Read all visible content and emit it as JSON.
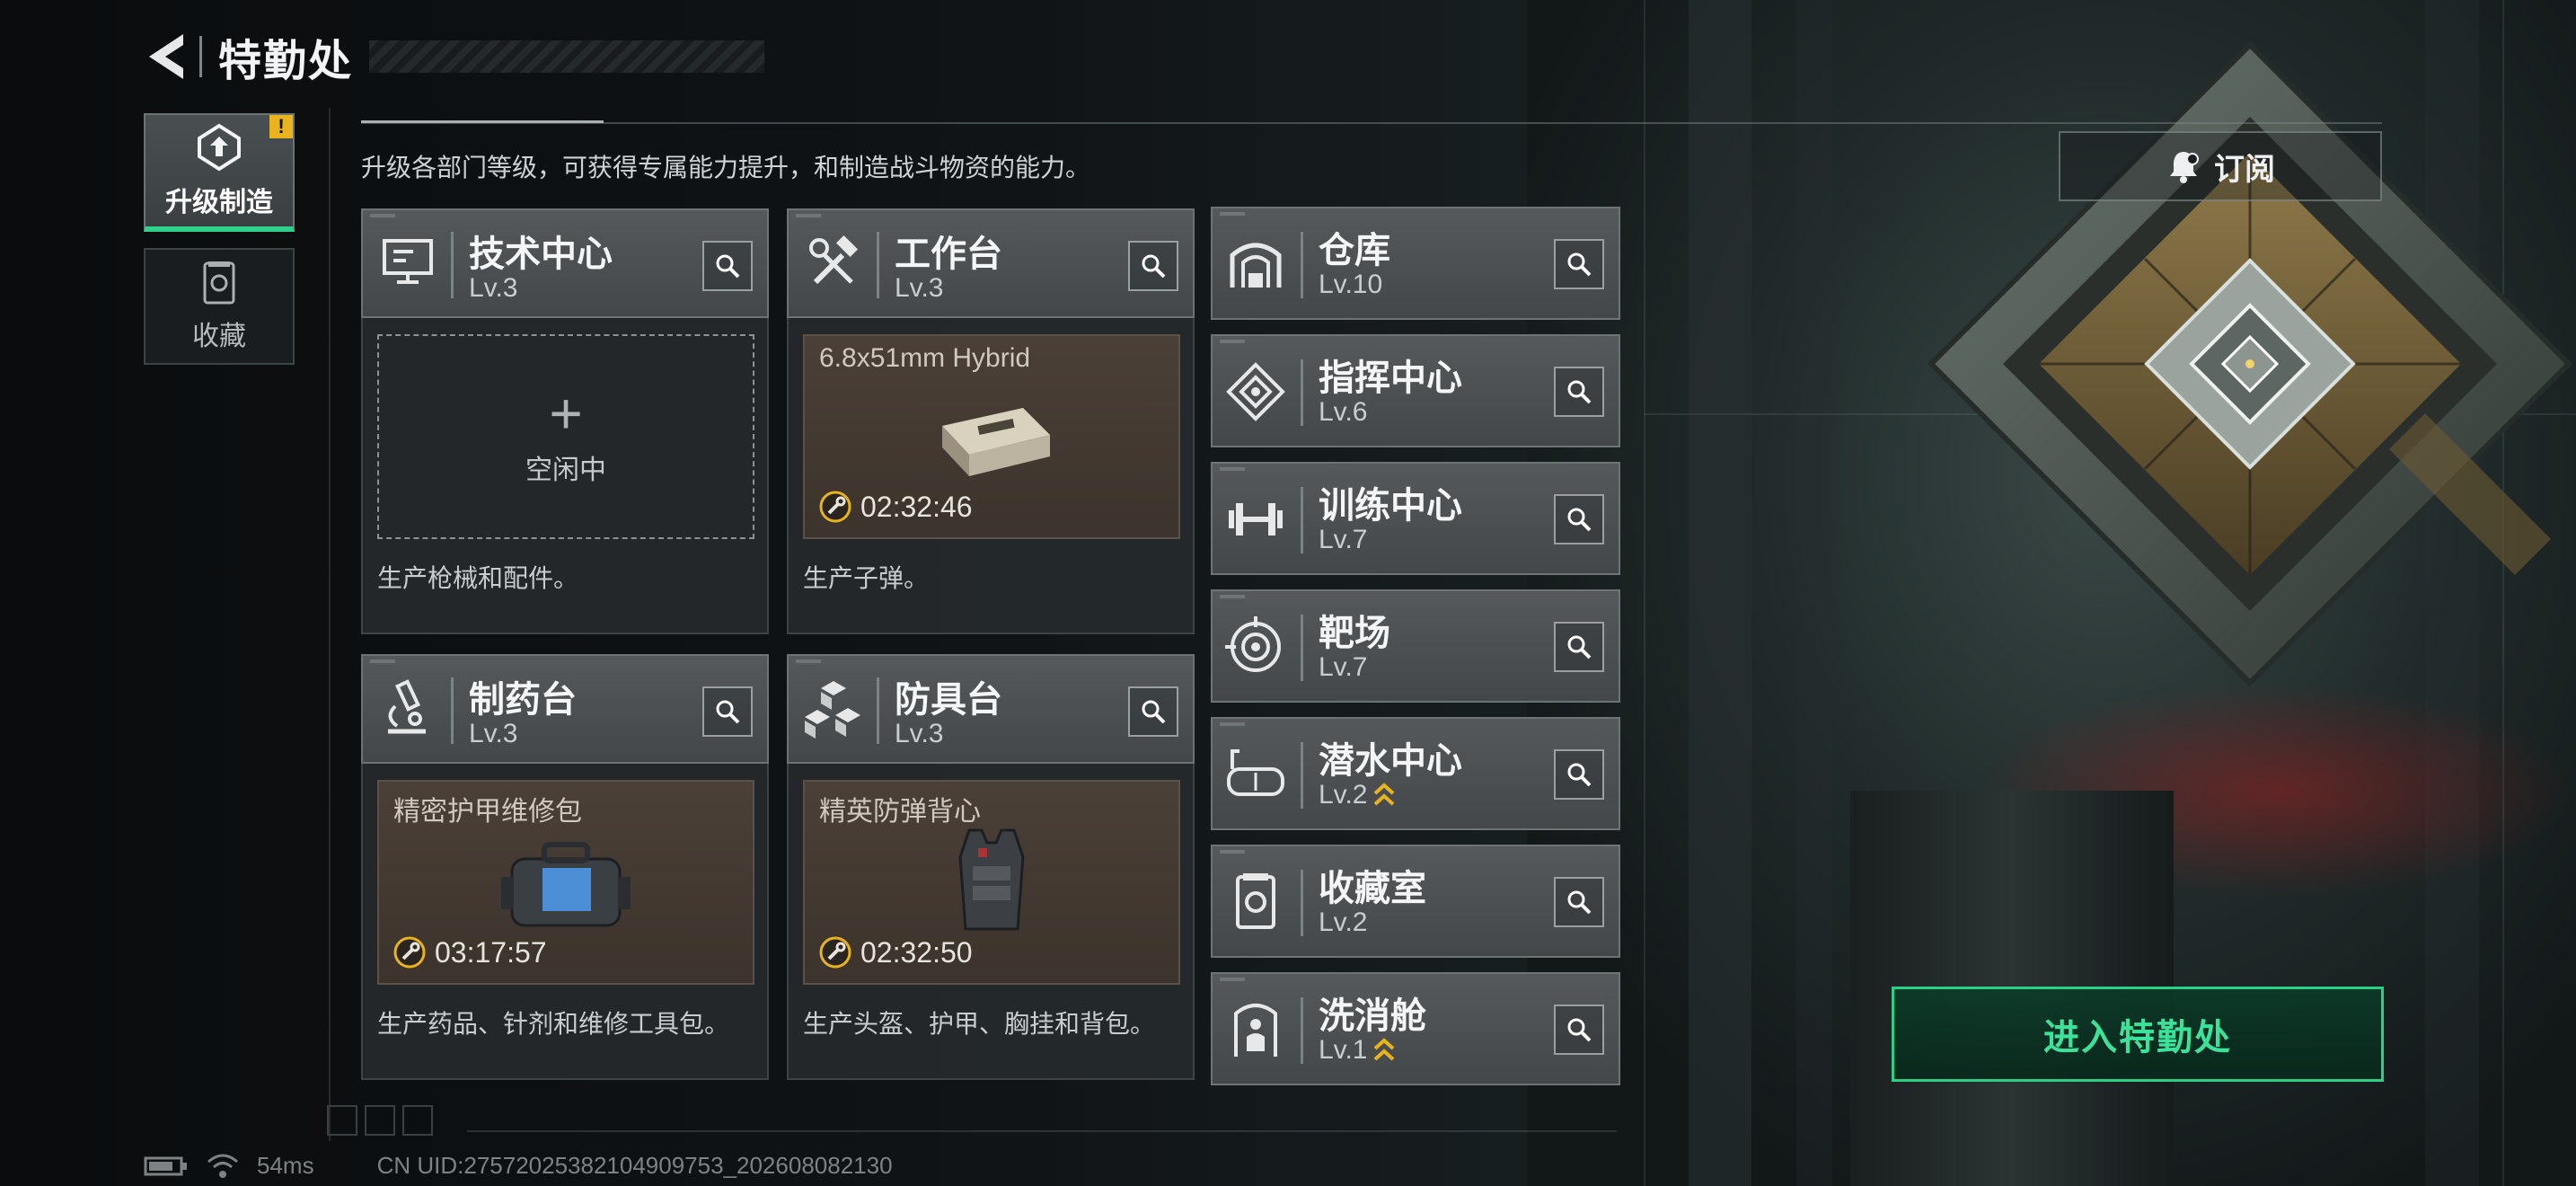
{
  "header": {
    "title": "特勤处"
  },
  "sidebar": {
    "items": [
      {
        "label": "升级制造",
        "active": true,
        "badge": "!"
      },
      {
        "label": "收藏",
        "active": false
      }
    ]
  },
  "subtitle": "升级各部门等级，可获得专属能力提升，和制造战斗物资的能力。",
  "subscribe": {
    "label": "订阅"
  },
  "workshops": [
    {
      "name": "技术中心",
      "level": "Lv.3",
      "status": "idle",
      "idle_label": "空闲中",
      "description": "生产枪械和配件。",
      "icon": "monitor-icon"
    },
    {
      "name": "工作台",
      "level": "Lv.3",
      "status": "busy",
      "item": "6.8x51mm Hybrid",
      "timer": "02:32:46",
      "description": "生产子弹。",
      "icon": "tools-icon"
    },
    {
      "name": "制药台",
      "level": "Lv.3",
      "status": "busy",
      "item": "精密护甲维修包",
      "timer": "03:17:57",
      "description": "生产药品、针剂和维修工具包。",
      "icon": "microscope-icon"
    },
    {
      "name": "防具台",
      "level": "Lv.3",
      "status": "busy",
      "item": "精英防弹背心",
      "timer": "02:32:50",
      "description": "生产头盔、护甲、胸挂和背包。",
      "icon": "boxes-icon"
    }
  ],
  "facilities": [
    {
      "name": "仓库",
      "level": "Lv.10",
      "upgrade": false,
      "icon": "warehouse-icon"
    },
    {
      "name": "指挥中心",
      "level": "Lv.6",
      "upgrade": false,
      "icon": "command-icon"
    },
    {
      "name": "训练中心",
      "level": "Lv.7",
      "upgrade": false,
      "icon": "dumbbell-icon"
    },
    {
      "name": "靶场",
      "level": "Lv.7",
      "upgrade": false,
      "icon": "target-icon"
    },
    {
      "name": "潜水中心",
      "level": "Lv.2",
      "upgrade": true,
      "icon": "diving-mask-icon"
    },
    {
      "name": "收藏室",
      "level": "Lv.2",
      "upgrade": false,
      "icon": "collection-icon"
    },
    {
      "name": "洗消舱",
      "level": "Lv.1",
      "upgrade": true,
      "icon": "decon-icon"
    }
  ],
  "enter_button": {
    "label": "进入特勤处"
  },
  "footer": {
    "ping": "54ms",
    "uid": "CN UID:27572025382104909753_202608082130"
  },
  "colors": {
    "accent": "#2ccf86",
    "badge": "#e8b31c",
    "upgrade": "#e8b31c",
    "timer_ring": "#e8b31c"
  }
}
